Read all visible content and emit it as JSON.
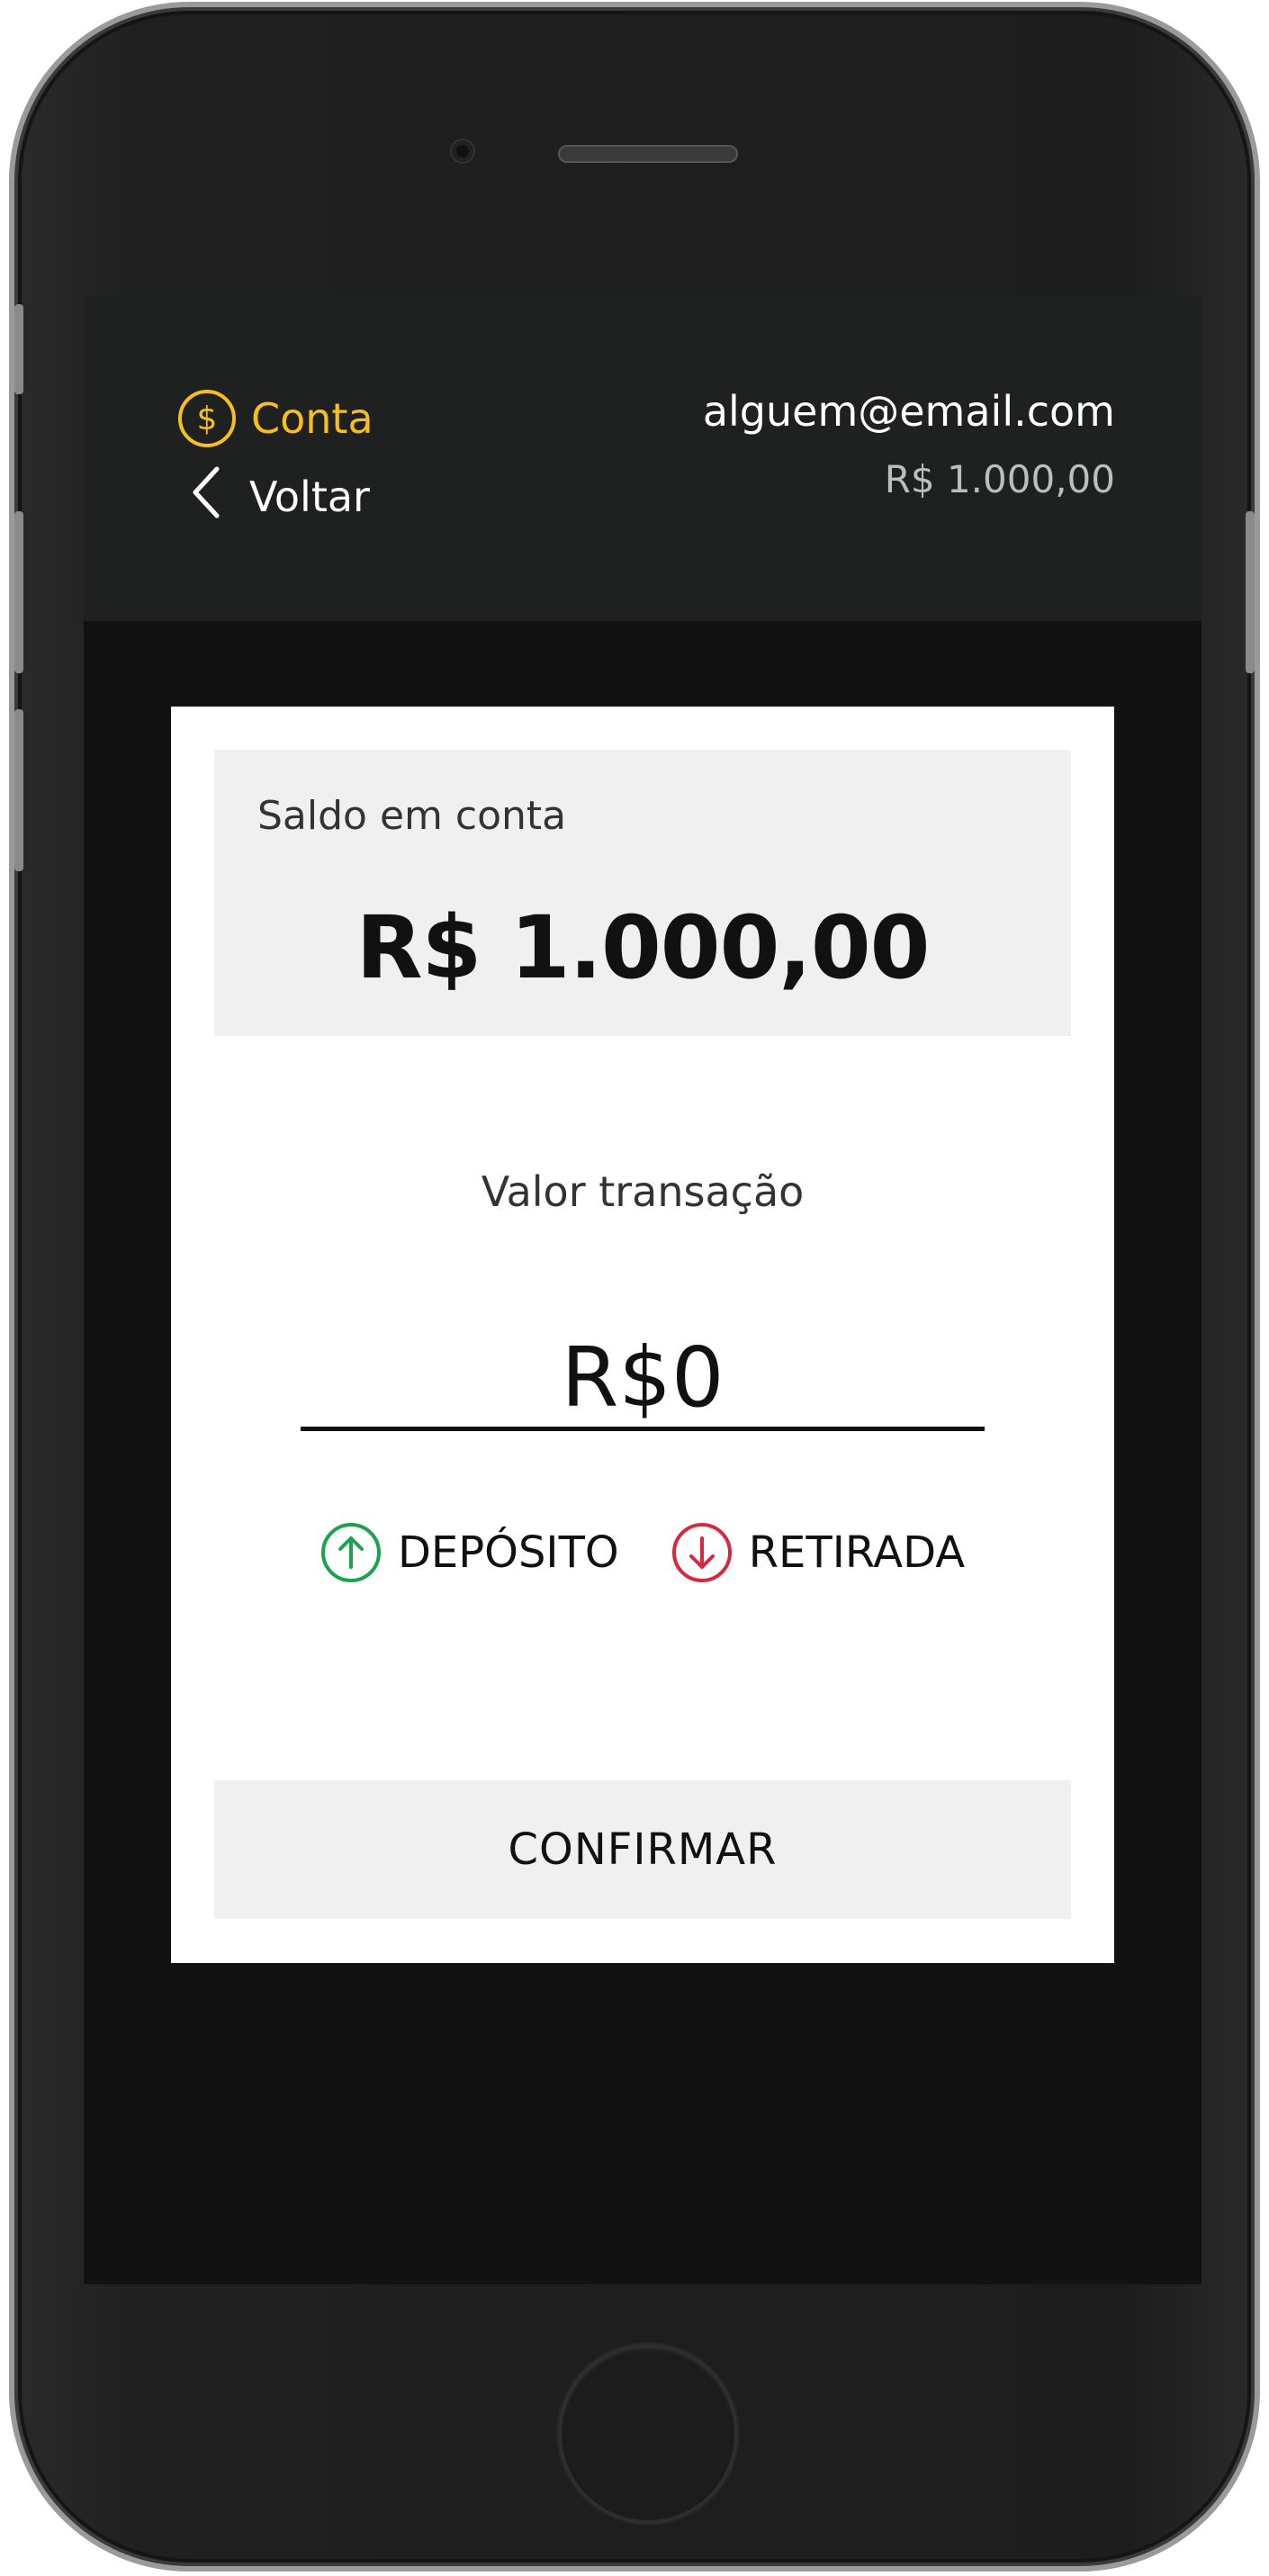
{
  "header": {
    "account_label": "Conta",
    "back_label": "Voltar",
    "email": "alguem@email.com",
    "balance": "R$ 1.000,00"
  },
  "balance_card": {
    "label": "Saldo em conta",
    "value": "R$ 1.000,00"
  },
  "transaction": {
    "label": "Valor transação",
    "amount_value": "R$0",
    "options": [
      {
        "label": "DEPÓSITO",
        "icon": "arrow-up-circle-icon",
        "color": "#1aa34a"
      },
      {
        "label": "RETIRADA",
        "icon": "arrow-down-circle-icon",
        "color": "#d6283f"
      }
    ],
    "confirm_label": "CONFIRMAR"
  },
  "colors": {
    "accent": "#f6bf1f",
    "header_bg": "#1f2020",
    "screen_bg": "#121212",
    "card_bg": "#ffffff",
    "panel_bg": "#f0f0f0"
  }
}
